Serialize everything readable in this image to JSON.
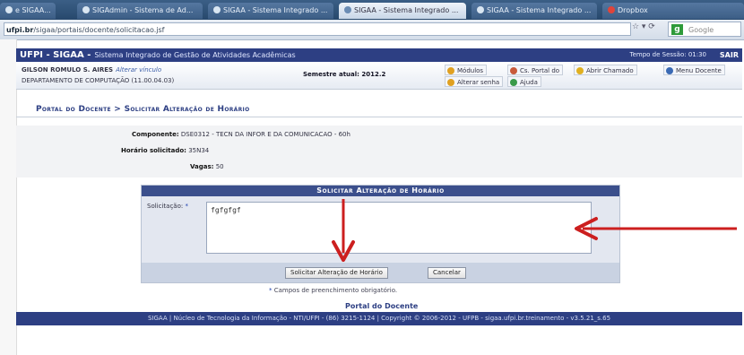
{
  "browser": {
    "tabs": [
      {
        "label": "e SIGAA..."
      },
      {
        "label": "SIGAdmin - Sistema de Ad..."
      },
      {
        "label": "SIGAA - Sistema Integrado ..."
      },
      {
        "label": "SIGAA - Sistema Integrado ..."
      },
      {
        "label": "SIGAA - Sistema Integrado ..."
      },
      {
        "label": "Dropbox"
      }
    ],
    "url_prefix": "ufpi.br",
    "url_path": "/sigaa/portais/docente/solicitacao.jsf",
    "search_placeholder": "Google"
  },
  "header": {
    "system": "UFPI - SIGAA -",
    "subtitle": "Sistema Integrado de Gestão de Atividades Acadêmicas",
    "session": "Tempo de Sessão: 01:30",
    "logout": "SAIR",
    "user": "GILSON ROMULO S. AIRES",
    "change_link": "Alterar vínculo",
    "department": "DEPARTAMENTO DE COMPUTAÇÃO (11.00.04.03)",
    "semester": "Semestre atual: 2012.2",
    "toolbar": {
      "modules": "Módulos",
      "portal": "Cs. Portal do",
      "chamado": "Abrir Chamado",
      "mensagem": "Menu Docente",
      "alterar": "Alterar senha",
      "ajuda": "Ajuda"
    }
  },
  "page": {
    "breadcrumb": "Portal do Docente > Solicitar Alteração de Horário",
    "componente_label": "Componente:",
    "componente_value": "DSE0312 - TECN DA INFOR E DA COMUNICACAO - 60h",
    "horario_label": "Horário solicitado:",
    "horario_value": "35N34",
    "vagas_label": "Vagas:",
    "vagas_value": "50"
  },
  "form": {
    "caption": "Solicitar Alteração de Horário",
    "field_label": "Solicitação:",
    "required_mark": "*",
    "field_value": "fgfgfgf",
    "submit_label": "Solicitar Alteração de Horário",
    "cancel_label": "Cancelar",
    "required_note": "Campos de preenchimento obrigatório."
  },
  "footer": {
    "portal_link": "Portal do Docente",
    "text": "SIGAA | Núcleo de Tecnologia da Informação - NTI/UFPI - (86) 3215-1124 | Copyright © 2006-2012 - UFPB - sigaa.ufpi.br.treinamento - v3.5.21_s.65"
  },
  "colors": {
    "header_blue": "#2d3f83",
    "annotation_red": "#cc1f1f"
  }
}
